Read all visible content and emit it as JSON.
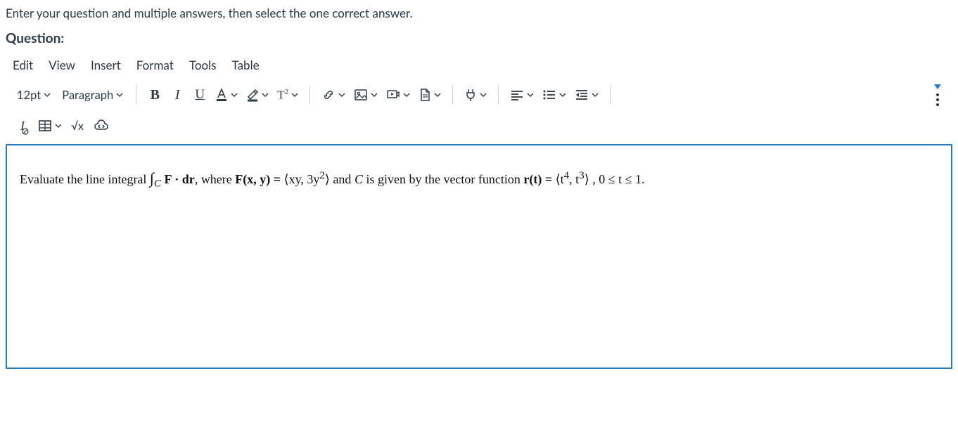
{
  "instructions": "Enter your question and multiple answers, then select the one correct answer.",
  "question_label": "Question:",
  "menubar": {
    "edit": "Edit",
    "view": "View",
    "insert": "Insert",
    "format": "Format",
    "tools": "Tools",
    "table": "Table"
  },
  "toolbar": {
    "font_size": "12pt",
    "block_format": "Paragraph",
    "bold": "B",
    "italic": "I",
    "underline": "U",
    "superscript": "T",
    "superscript_exp": "2",
    "clear_format": "I",
    "sqrt_label": "√x"
  },
  "content": {
    "prefix": "Evaluate the line integral ",
    "int_sub": "C",
    "f_dot_dr": " F · dr",
    "mid1": ", where ",
    "F_of": "F(x, y) = ",
    "vec1": "⟨xy, 3y",
    "vec1_sup": "2",
    "vec1_close": "⟩",
    "mid2": " and ",
    "C_is": "C",
    "mid3": " is given by the vector function ",
    "r_of": "r(t) = ",
    "vec2_open": "⟨t",
    "vec2_sup1": "4",
    "vec2_mid": ", t",
    "vec2_sup2": "3",
    "vec2_close": "⟩",
    "tail": " , 0 ≤ t ≤ 1."
  }
}
